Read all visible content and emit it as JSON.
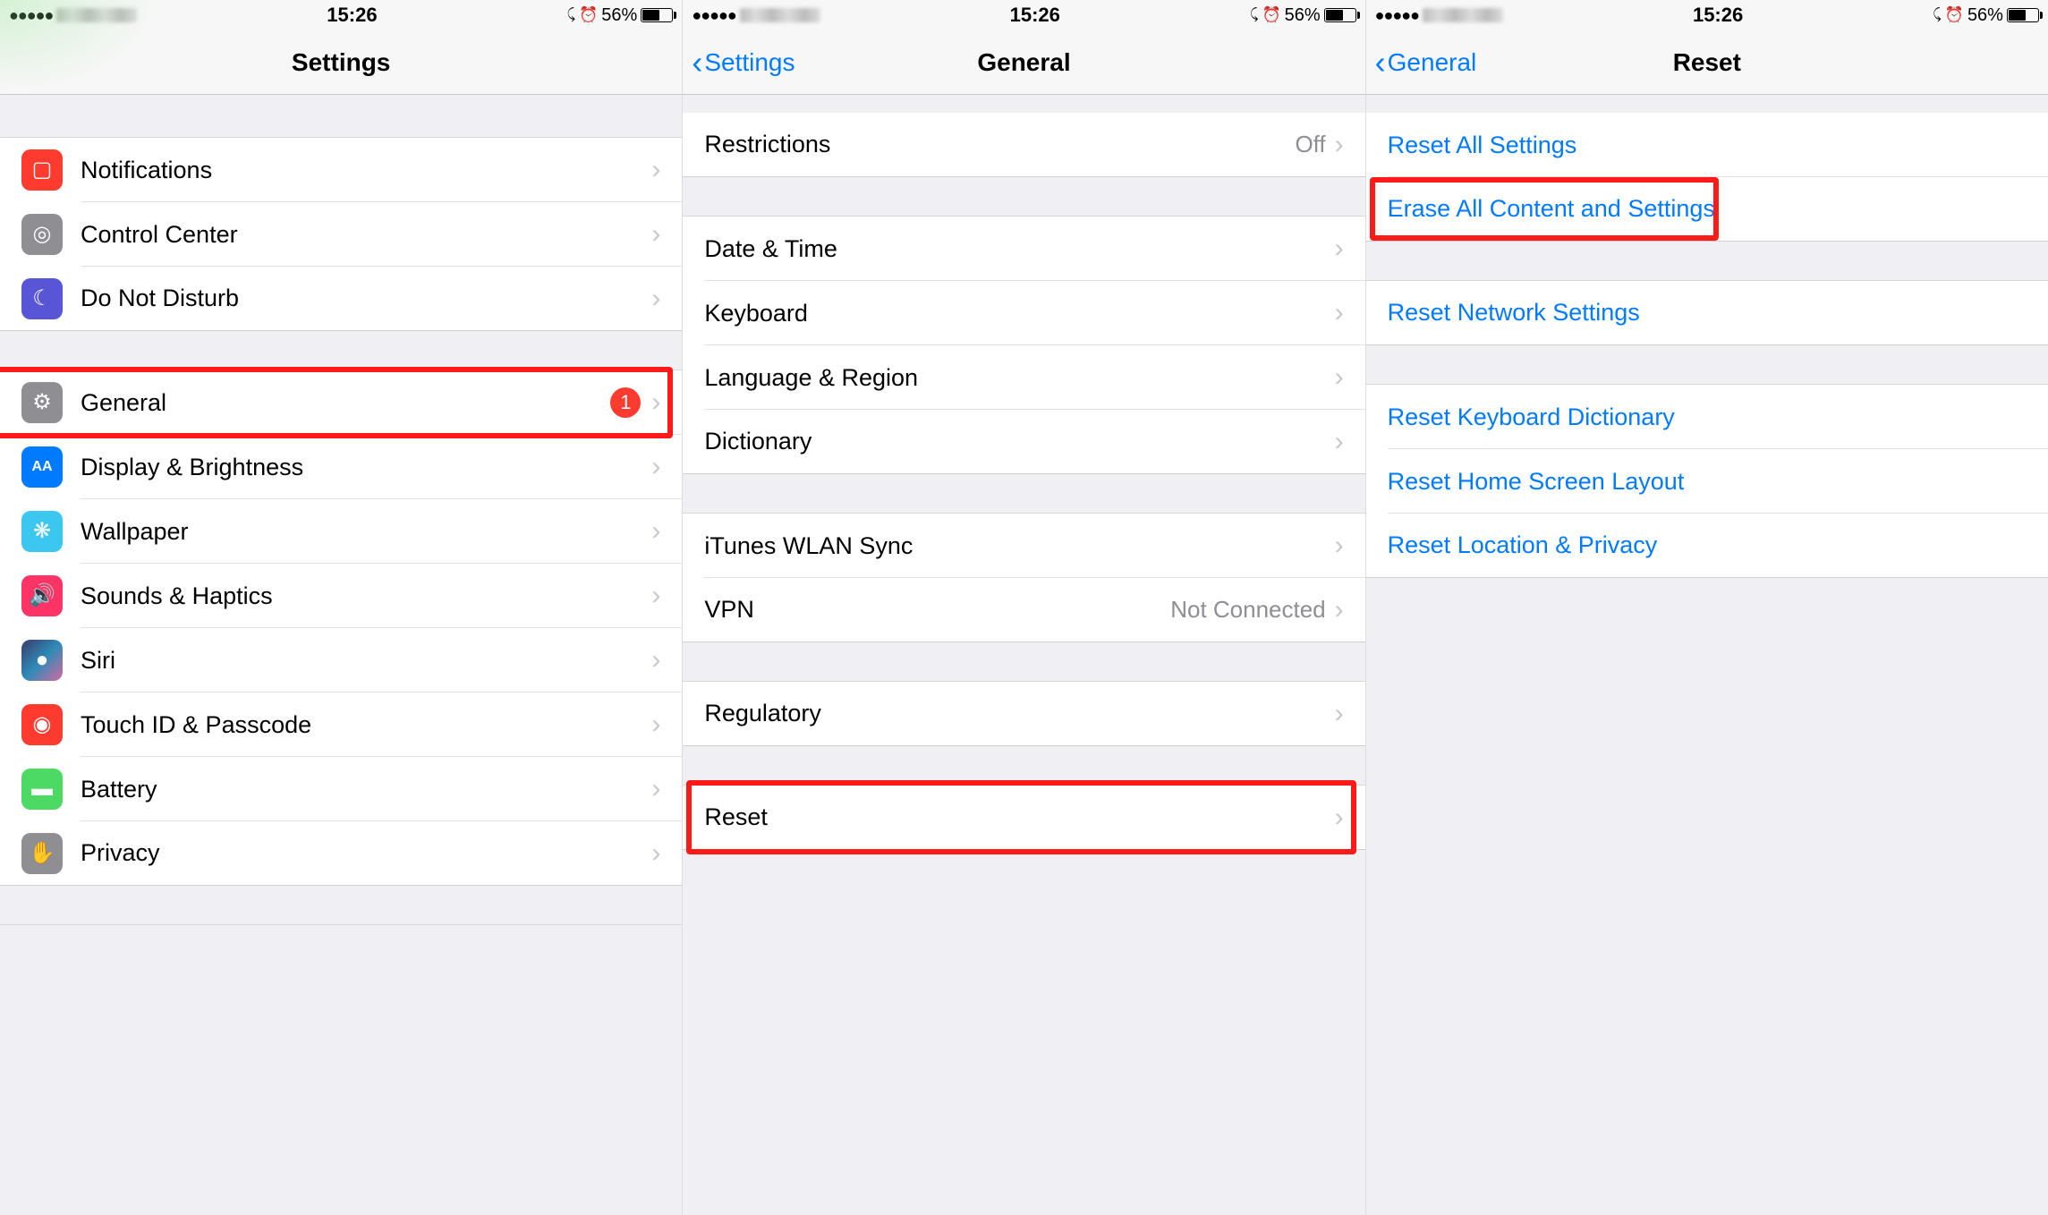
{
  "status": {
    "time": "15:26",
    "battery_pct": "56%",
    "lock": "⟲",
    "alarm": "⏰"
  },
  "screens": [
    {
      "title": "Settings",
      "back_label": "",
      "groups": [
        {
          "rows": [
            {
              "icon_class": "ic-red",
              "glyph": "▢",
              "label": "Notifications"
            },
            {
              "icon_class": "ic-grey",
              "glyph": "◎",
              "label": "Control Center"
            },
            {
              "icon_class": "ic-purple",
              "glyph": "☾",
              "label": "Do Not Disturb"
            }
          ]
        },
        {
          "rows": [
            {
              "icon_class": "ic-grey",
              "glyph": "⚙",
              "label": "General",
              "badge": "1",
              "highlight": true
            },
            {
              "icon_class": "ic-blue",
              "glyph": "AA",
              "label": "Display & Brightness"
            },
            {
              "icon_class": "ic-cyan",
              "glyph": "❋",
              "label": "Wallpaper"
            },
            {
              "icon_class": "ic-darkpink",
              "glyph": "🔊",
              "label": "Sounds & Haptics"
            },
            {
              "icon_class": "ic-siri",
              "glyph": "●",
              "label": "Siri"
            },
            {
              "icon_class": "ic-red",
              "glyph": "◉",
              "label": "Touch ID & Passcode"
            },
            {
              "icon_class": "ic-green",
              "glyph": "▬",
              "label": "Battery"
            },
            {
              "icon_class": "ic-grey",
              "glyph": "✋",
              "label": "Privacy"
            }
          ]
        }
      ]
    },
    {
      "title": "General",
      "back_label": "Settings",
      "groups": [
        {
          "rows": [
            {
              "label": "Restrictions",
              "detail": "Off"
            }
          ]
        },
        {
          "rows": [
            {
              "label": "Date & Time"
            },
            {
              "label": "Keyboard"
            },
            {
              "label": "Language & Region"
            },
            {
              "label": "Dictionary"
            }
          ]
        },
        {
          "rows": [
            {
              "label": "iTunes WLAN Sync"
            },
            {
              "label": "VPN",
              "detail": "Not Connected"
            }
          ]
        },
        {
          "rows": [
            {
              "label": "Regulatory"
            }
          ]
        },
        {
          "rows": [
            {
              "label": "Reset",
              "highlight": true
            }
          ]
        }
      ]
    },
    {
      "title": "Reset",
      "back_label": "General",
      "groups": [
        {
          "rows": [
            {
              "label": "Reset All Settings",
              "link": true
            },
            {
              "label": "Erase All Content and Settings",
              "link": true,
              "highlight": true
            }
          ]
        },
        {
          "rows": [
            {
              "label": "Reset Network Settings",
              "link": true
            }
          ]
        },
        {
          "rows": [
            {
              "label": "Reset Keyboard Dictionary",
              "link": true
            },
            {
              "label": "Reset Home Screen Layout",
              "link": true
            },
            {
              "label": "Reset Location & Privacy",
              "link": true
            }
          ]
        }
      ]
    }
  ]
}
